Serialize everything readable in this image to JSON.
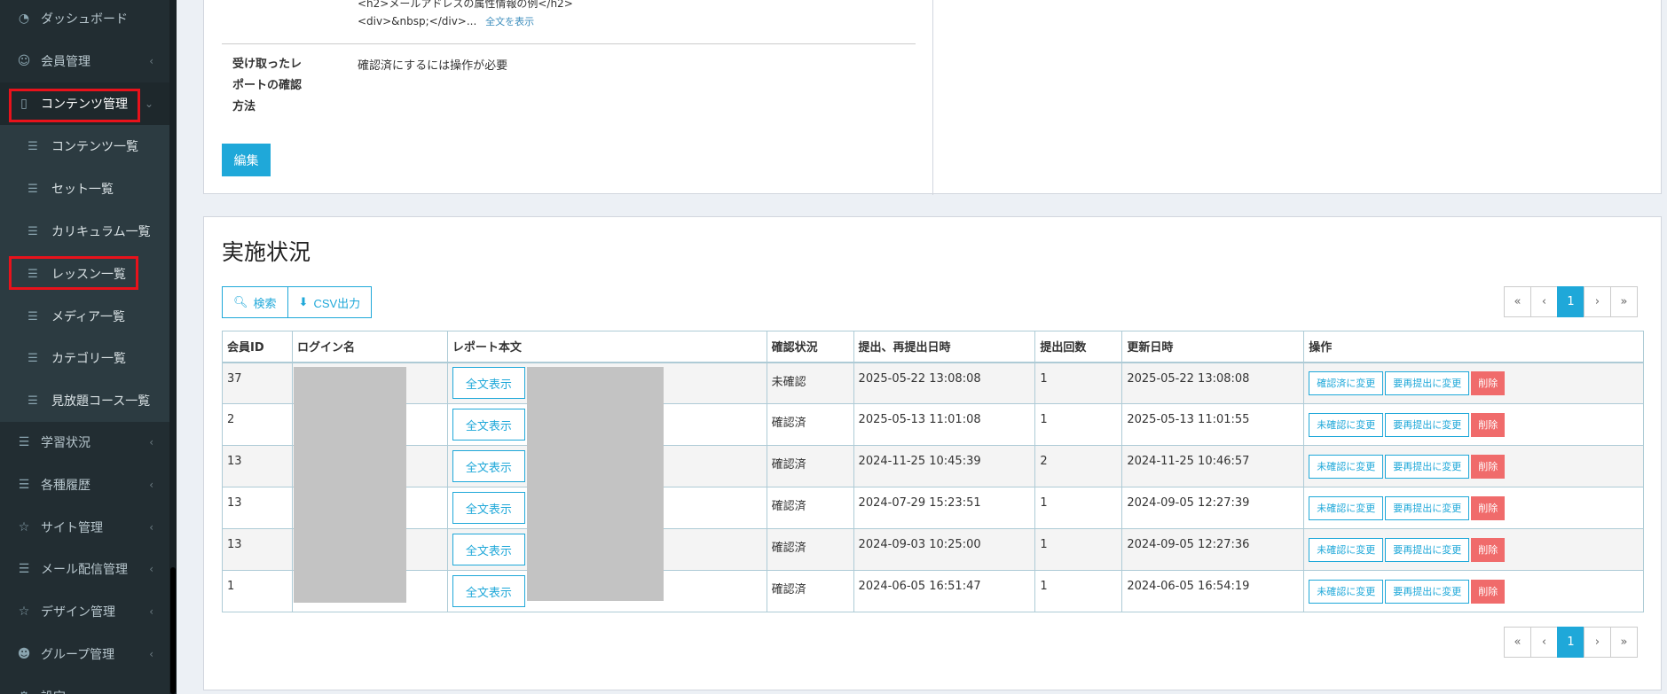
{
  "sidebar": {
    "items": [
      {
        "label": "ダッシュボード",
        "icon": "dashboard-icon"
      },
      {
        "label": "会員管理",
        "icon": "user-icon"
      },
      {
        "label": "コンテンツ管理",
        "icon": "book-icon"
      },
      {
        "label": "コンテンツ一覧",
        "icon": "list-icon"
      },
      {
        "label": "セット一覧",
        "icon": "list-icon"
      },
      {
        "label": "カリキュラム一覧",
        "icon": "list-icon"
      },
      {
        "label": "レッスン一覧",
        "icon": "list-icon"
      },
      {
        "label": "メディア一覧",
        "icon": "list-icon"
      },
      {
        "label": "カテゴリ一覧",
        "icon": "list-icon"
      },
      {
        "label": "見放題コース一覧",
        "icon": "list-icon"
      },
      {
        "label": "学習状況",
        "icon": "list-icon"
      },
      {
        "label": "各種履歴",
        "icon": "list-icon"
      },
      {
        "label": "サイト管理",
        "icon": "star-icon"
      },
      {
        "label": "メール配信管理",
        "icon": "list-icon"
      },
      {
        "label": "デザイン管理",
        "icon": "star-icon"
      },
      {
        "label": "グループ管理",
        "icon": "group-icon"
      },
      {
        "label": "設定",
        "icon": "gear-icon"
      }
    ]
  },
  "detail": {
    "cut_text": "<h2>メールアドレスの属性情報の例</h2>",
    "preview_text": "<div>&nbsp;</div>...",
    "show_full": "全文を表示",
    "confirm_label": "受け取ったレポートの確認方法",
    "confirm_value": "確認済にするには操作が必要",
    "edit_label": "編集"
  },
  "status": {
    "title": "実施状況",
    "search_label": "検索",
    "csv_label": "CSV出力",
    "pager": [
      "«",
      "‹",
      "1",
      "›",
      "»"
    ],
    "columns": [
      "会員ID",
      "ログイン名",
      "レポート本文",
      "確認状況",
      "提出、再提出日時",
      "提出回数",
      "更新日時",
      "操作"
    ],
    "full_btn": "全文表示",
    "btn_confirmed": "確認済に変更",
    "btn_unconfirmed": "未確認に変更",
    "btn_resubmit": "要再提出に変更",
    "btn_delete": "削除",
    "rows": [
      {
        "id": "37",
        "status": "未確認",
        "submitted": "2025-05-22 13:08:08",
        "count": "1",
        "updated": "2025-05-22 13:08:08"
      },
      {
        "id": "2",
        "status": "確認済",
        "submitted": "2025-05-13 11:01:08",
        "count": "1",
        "updated": "2025-05-13 11:01:55"
      },
      {
        "id": "13",
        "status": "確認済",
        "submitted": "2024-11-25 10:45:39",
        "count": "2",
        "updated": "2024-11-25 10:46:57"
      },
      {
        "id": "13",
        "status": "確認済",
        "submitted": "2024-07-29 15:23:51",
        "count": "1",
        "updated": "2024-09-05 12:27:39"
      },
      {
        "id": "13",
        "status": "確認済",
        "submitted": "2024-09-03 10:25:00",
        "count": "1",
        "updated": "2024-09-05 12:27:36"
      },
      {
        "id": "1",
        "status": "確認済",
        "submitted": "2024-06-05 16:51:47",
        "count": "1",
        "updated": "2024-06-05 16:54:19"
      }
    ]
  },
  "colors": {
    "accent": "#1fa8d9",
    "danger": "#f06b6b",
    "sidebar": "#222d32",
    "highlight": "#e8121b"
  }
}
